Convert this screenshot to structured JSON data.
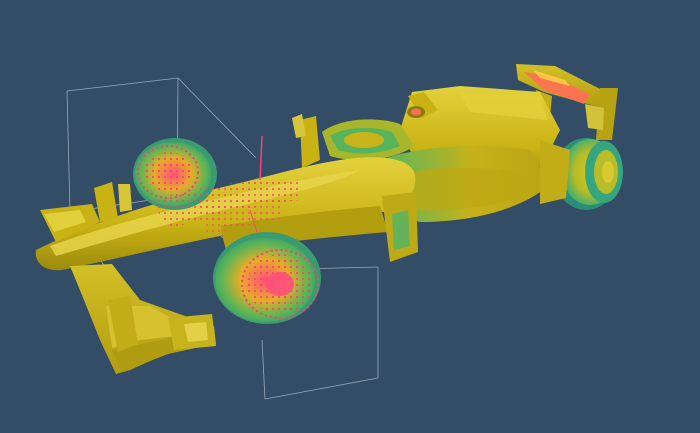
{
  "viewport": {
    "background_color": "#344d66",
    "model_palette": {
      "body": "#c9b214",
      "body_light": "#e2cf3c",
      "body_dark": "#8f7f0a",
      "stress_green": "#45b85e",
      "stress_cyan": "#3fb4a8",
      "hotspot": "#ff3f76",
      "rear_wing_hot": "#ff6f57",
      "bounding_box": "#aab7c6"
    }
  }
}
